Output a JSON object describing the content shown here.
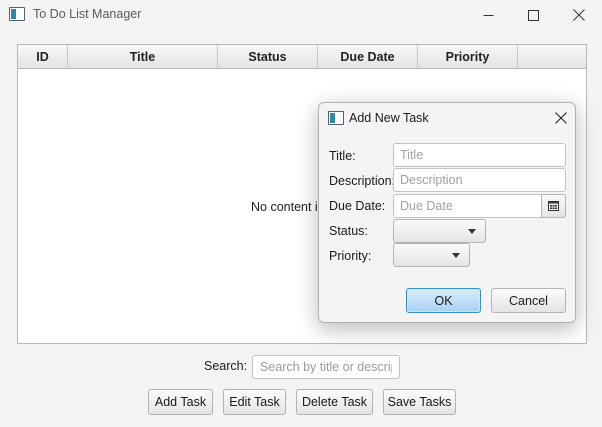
{
  "window": {
    "title": "To Do List Manager",
    "icon": "app-window-icon",
    "controls": {
      "minimize": "—",
      "maximize": "☐",
      "close": "✕"
    }
  },
  "table": {
    "columns": [
      "ID",
      "Title",
      "Status",
      "Due Date",
      "Priority"
    ],
    "rows": [],
    "empty_message": "No content in table"
  },
  "search": {
    "label": "Search:",
    "placeholder": "Search by title or description",
    "value": ""
  },
  "actions": {
    "add": "Add Task",
    "edit": "Edit Task",
    "delete": "Delete Task",
    "save": "Save Tasks"
  },
  "dialog": {
    "title": "Add New Task",
    "close": "✕",
    "fields": {
      "title": {
        "label": "Title:",
        "placeholder": "Title",
        "value": ""
      },
      "description": {
        "label": "Description:",
        "placeholder": "Description",
        "value": ""
      },
      "due_date": {
        "label": "Due Date:",
        "placeholder": "Due Date",
        "value": "",
        "picker_icon": "calendar-icon"
      },
      "status": {
        "label": "Status:",
        "selected": ""
      },
      "priority": {
        "label": "Priority:",
        "selected": ""
      }
    },
    "ok": "OK",
    "cancel": "Cancel"
  },
  "colors": {
    "accent": "#3a8fd0",
    "window_bg": "#f3f3f3",
    "header_bg": "#e4e4e4"
  }
}
